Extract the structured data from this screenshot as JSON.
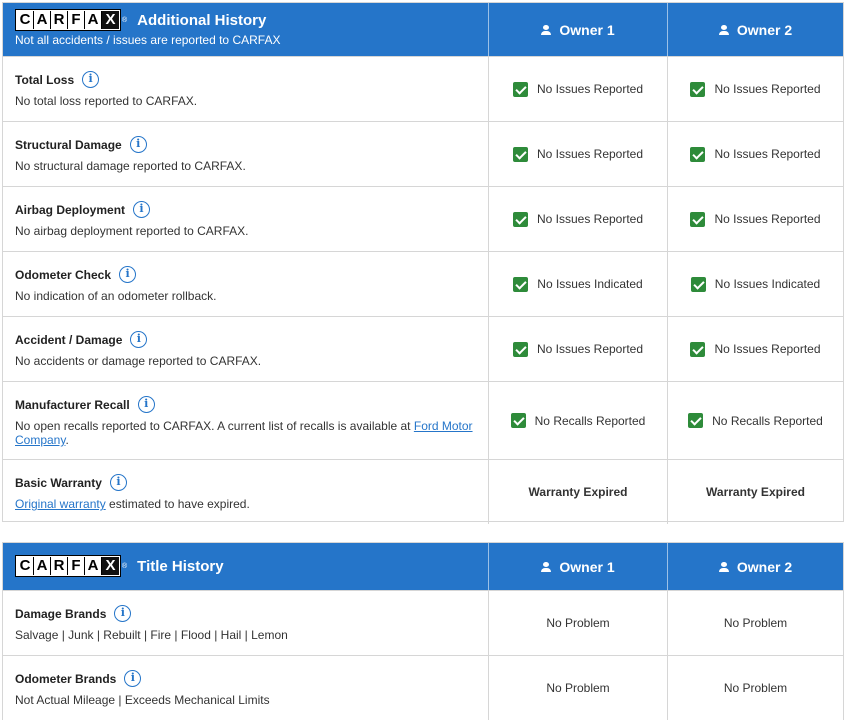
{
  "additional": {
    "logo": "CARFAX",
    "trademark": "®",
    "title": "Additional History",
    "subtitle": "Not all accidents / issues are reported to CARFAX",
    "owner1": "Owner 1",
    "owner2": "Owner 2",
    "rows": [
      {
        "title": "Total Loss",
        "desc": "No total loss reported to CARFAX.",
        "o1": "No Issues Reported",
        "o2": "No Issues Reported"
      },
      {
        "title": "Structural Damage",
        "desc": "No structural damage reported to CARFAX.",
        "o1": "No Issues Reported",
        "o2": "No Issues Reported"
      },
      {
        "title": "Airbag Deployment",
        "desc": "No airbag deployment reported to CARFAX.",
        "o1": "No Issues Reported",
        "o2": "No Issues Reported"
      },
      {
        "title": "Odometer Check",
        "desc": "No indication of an odometer rollback.",
        "o1": "No Issues Indicated",
        "o2": "No Issues Indicated"
      },
      {
        "title": "Accident / Damage",
        "desc": "No accidents or damage reported to CARFAX.",
        "o1": "No Issues Reported",
        "o2": "No Issues Reported"
      },
      {
        "title": "Manufacturer Recall",
        "desc": "No open recalls reported to CARFAX. A current list of recalls is available at ",
        "link": "Ford Motor Company",
        "desc_end": ".",
        "o1": "No Recalls Reported",
        "o2": "No Recalls Reported"
      },
      {
        "title": "Basic Warranty",
        "link": "Original warranty",
        "desc_end": " estimated to have expired.",
        "o1": "Warranty Expired",
        "o2": "Warranty Expired"
      }
    ]
  },
  "title_history": {
    "logo": "CARFAX",
    "trademark": "®",
    "title": "Title History",
    "owner1": "Owner 1",
    "owner2": "Owner 2",
    "rows": [
      {
        "title": "Damage Brands",
        "desc": "Salvage | Junk | Rebuilt | Fire | Flood | Hail | Lemon",
        "o1": "No Problem",
        "o2": "No Problem"
      },
      {
        "title": "Odometer Brands",
        "desc": "Not Actual Mileage | Exceeds Mechanical Limits",
        "o1": "No Problem",
        "o2": "No Problem"
      }
    ]
  },
  "icons": {
    "info": "info-icon",
    "check": "check-icon",
    "owner": "person-icon"
  },
  "colors": {
    "header": "#2575c9",
    "check": "#2e8b3a",
    "link": "#2575c9"
  }
}
